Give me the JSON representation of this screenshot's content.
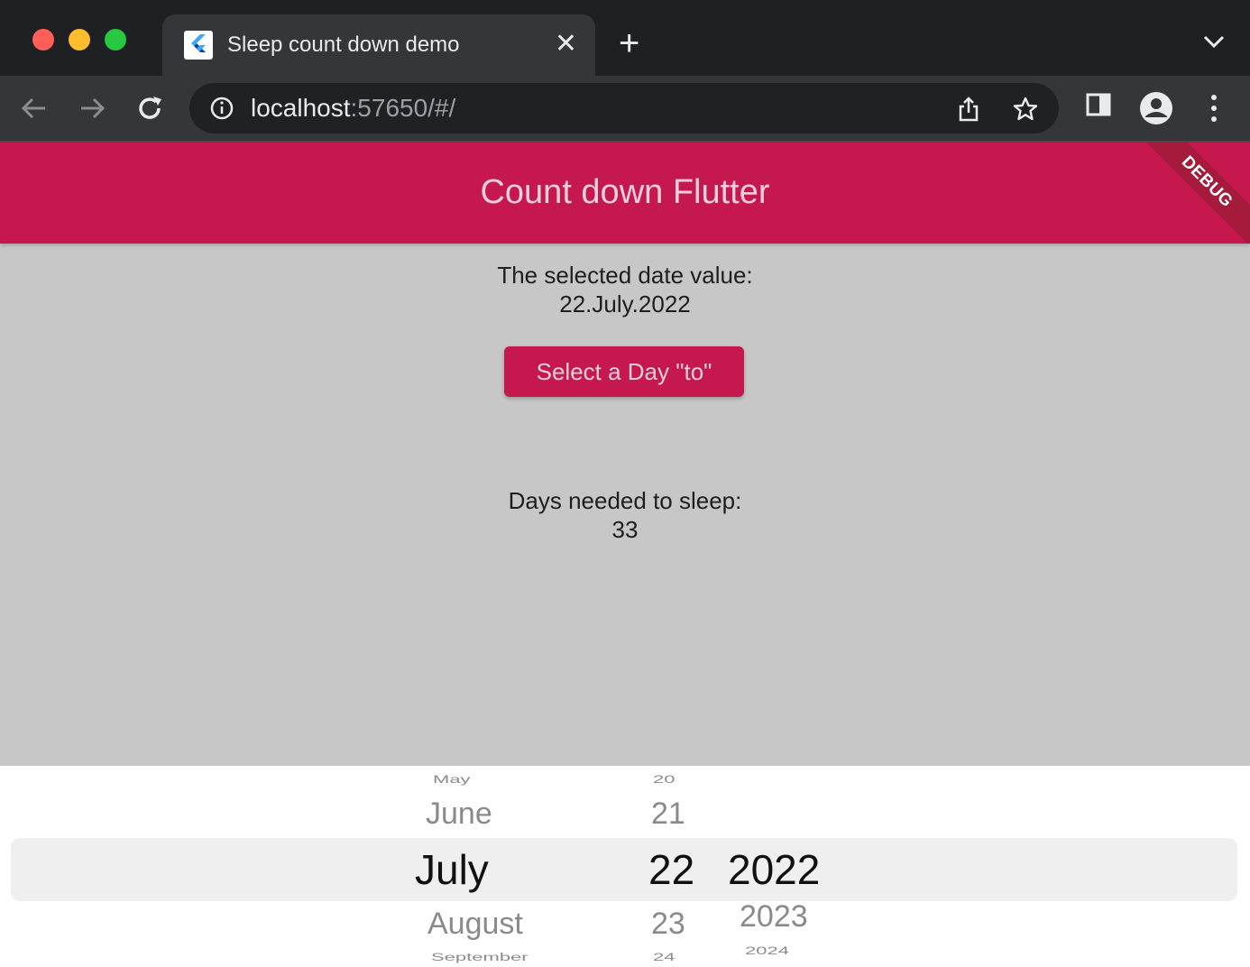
{
  "browser": {
    "tab_title": "Sleep count down demo",
    "tab_close_icon": "close-icon",
    "new_tab_icon": "plus-icon",
    "url_host": "localhost",
    "url_rest": ":57650/#/"
  },
  "app": {
    "title": "Count down Flutter",
    "debug_label": "DEBUG",
    "selected_date_label": "The selected date value:",
    "selected_date_value": "22.July.2022",
    "select_button_label": "Select a Day \"to\"",
    "days_label": "Days needed to sleep:",
    "days_value": "33"
  },
  "picker": {
    "months": [
      "May",
      "June",
      "July",
      "August",
      "September"
    ],
    "days": [
      "20",
      "21",
      "22",
      "23",
      "24"
    ],
    "years": [
      "2022",
      "2023",
      "2024"
    ],
    "selected": {
      "month": "July",
      "day": "22",
      "year": "2022"
    }
  },
  "colors": {
    "accent": "#c4184e",
    "page_background": "#c7c7c7",
    "browser_chrome": "#35363a"
  }
}
